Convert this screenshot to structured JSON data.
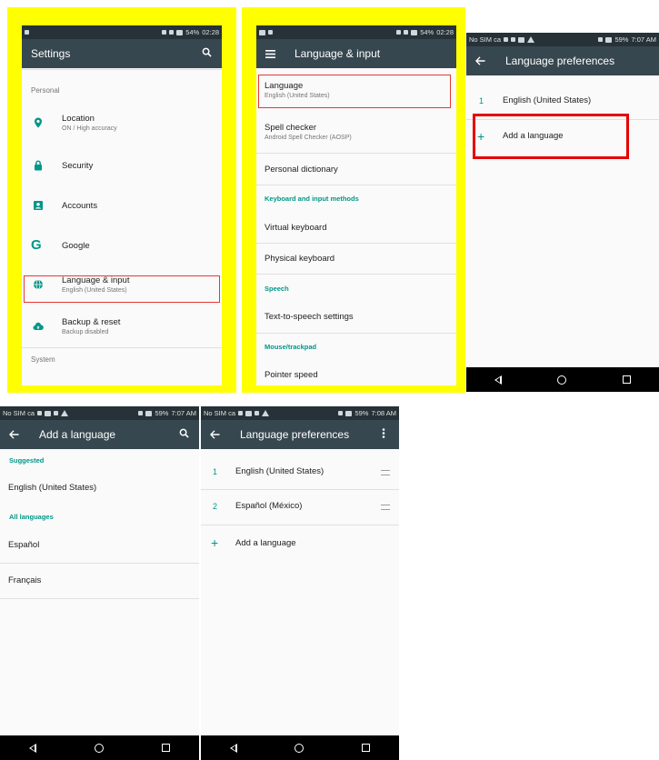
{
  "colors": {
    "frame": "#ffff00",
    "statusbar": "#263238",
    "appbar": "#37474f",
    "accent": "#009688",
    "highlight": "#e53935"
  },
  "screens": {
    "settings": {
      "status_battery": "54%",
      "status_time": "02:28",
      "title": "Settings",
      "section_personal": "Personal",
      "items": [
        {
          "title": "Location",
          "subtitle": "ON / High accuracy",
          "icon": "location-pin-icon"
        },
        {
          "title": "Security",
          "subtitle": "",
          "icon": "lock-icon"
        },
        {
          "title": "Accounts",
          "subtitle": "",
          "icon": "account-card-icon"
        },
        {
          "title": "Google",
          "subtitle": "",
          "icon": "google-g-icon"
        },
        {
          "title": "Language & input",
          "subtitle": "English (United States)",
          "icon": "globe-icon"
        },
        {
          "title": "Backup & reset",
          "subtitle": "Backup disabled",
          "icon": "cloud-upload-icon"
        }
      ],
      "section_system": "System"
    },
    "language_input": {
      "status_battery": "54%",
      "status_time": "02:28",
      "title": "Language & input",
      "language_title": "Language",
      "language_subtitle": "English (United States)",
      "spell_title": "Spell checker",
      "spell_subtitle": "Android Spell Checker (AOSP)",
      "personal_dictionary": "Personal dictionary",
      "section_keyboard": "Keyboard and input methods",
      "virtual_keyboard": "Virtual keyboard",
      "physical_keyboard": "Physical keyboard",
      "section_speech": "Speech",
      "tts_settings": "Text-to-speech settings",
      "section_mouse": "Mouse/trackpad",
      "pointer_speed": "Pointer speed"
    },
    "lang_prefs_1": {
      "status_carrier": "No SIM ca",
      "status_battery": "59%",
      "status_time": "7:07 AM",
      "title": "Language preferences",
      "languages": [
        {
          "num": "1",
          "name": "English (United States)"
        }
      ],
      "add_language": "Add a language"
    },
    "add_language": {
      "status_carrier": "No SIM ca",
      "status_battery": "59%",
      "status_time": "7:07 AM",
      "title": "Add a language",
      "section_suggested": "Suggested",
      "suggested": [
        "English (United States)"
      ],
      "section_all": "All languages",
      "all": [
        "Español",
        "Français"
      ]
    },
    "lang_prefs_2": {
      "status_carrier": "No SIM ca",
      "status_battery": "59%",
      "status_time": "7:08 AM",
      "title": "Language preferences",
      "languages": [
        {
          "num": "1",
          "name": "English (United States)"
        },
        {
          "num": "2",
          "name": "Español (México)"
        }
      ],
      "add_language": "Add a language"
    }
  }
}
